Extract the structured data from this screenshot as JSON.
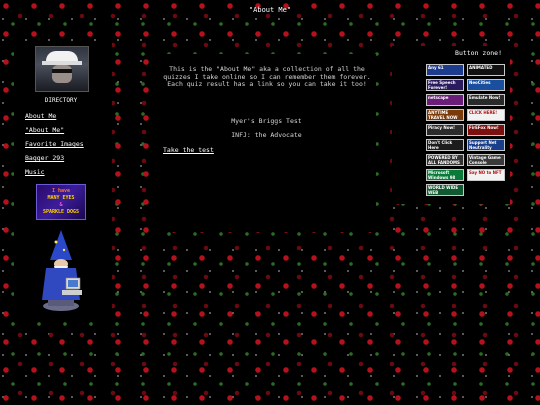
{
  "page": {
    "title": "\"About Me\""
  },
  "sidebar": {
    "heading": "DIRECTORY",
    "links": [
      "About Me",
      "\"About Me\"",
      "Favorite Images",
      "Bagger 293",
      "Music"
    ],
    "badge_lines": [
      "I have",
      "MANY EYES",
      "&",
      "SPARKLE DOGS"
    ]
  },
  "main": {
    "intro": "This is the \"About Me\" aka a collection of all the quizzes I take online so I can remember them forever. Each quiz result has a link so you can take it too!",
    "test_name": "Myer's Briggs Test",
    "test_result": "INFJ: the Advocate",
    "take_test_link": "Take the test"
  },
  "buttons_panel": {
    "heading": "Button zone!",
    "buttons": [
      {
        "label": "Any 61",
        "icon": "shield-icon",
        "bg": "#1d3c8e"
      },
      {
        "label": "ANIMATED",
        "icon": "waveform-icon",
        "bg": "#111111"
      },
      {
        "label": "Free Speech Forever!",
        "icon": "ribbon-icon",
        "bg": "#2a1a5e"
      },
      {
        "label": "NeoCities",
        "icon": "cloud-icon",
        "bg": "#1a4fa0"
      },
      {
        "label": "netscape",
        "icon": "browser-icon",
        "bg": "#6a1e7a"
      },
      {
        "label": "Emulate Now!",
        "icon": "gamepad-icon",
        "bg": "#2a2a2a"
      },
      {
        "label": "ANYTIME TRAVEL NOW",
        "icon": "clock-icon",
        "bg": "#7a3a0a"
      },
      {
        "label": "CLICK HERE!",
        "icon": "cursor-icon",
        "bg": "#f2f2f2"
      },
      {
        "label": "Piracy Now!",
        "icon": "skull-icon",
        "bg": "#2b2b2b"
      },
      {
        "label": "FirEFox Now!",
        "icon": "firefox-icon",
        "bg": "#7a1010"
      },
      {
        "label": "Don't Click Here",
        "icon": "warning-icon",
        "bg": "#1c1c1c"
      },
      {
        "label": "Support Net Neutrality",
        "icon": "globe-icon",
        "bg": "#1a3f8a"
      },
      {
        "label": "POWERED BY ALL FANDOMS",
        "icon": "star-icon",
        "bg": "#333333"
      },
      {
        "label": "Vintage Game Console",
        "icon": "console-icon",
        "bg": "#3a3a3a"
      },
      {
        "label": "Microsoft Windows 98",
        "icon": "windows-icon",
        "bg": "#0a7a3a"
      },
      {
        "label": "Say NO to NFT",
        "icon": "no-entry-icon",
        "bg": "#f2f2f2"
      },
      {
        "label": "WORLD WIDE WEB",
        "icon": "globe-icon",
        "bg": "#0f5a30"
      }
    ]
  }
}
